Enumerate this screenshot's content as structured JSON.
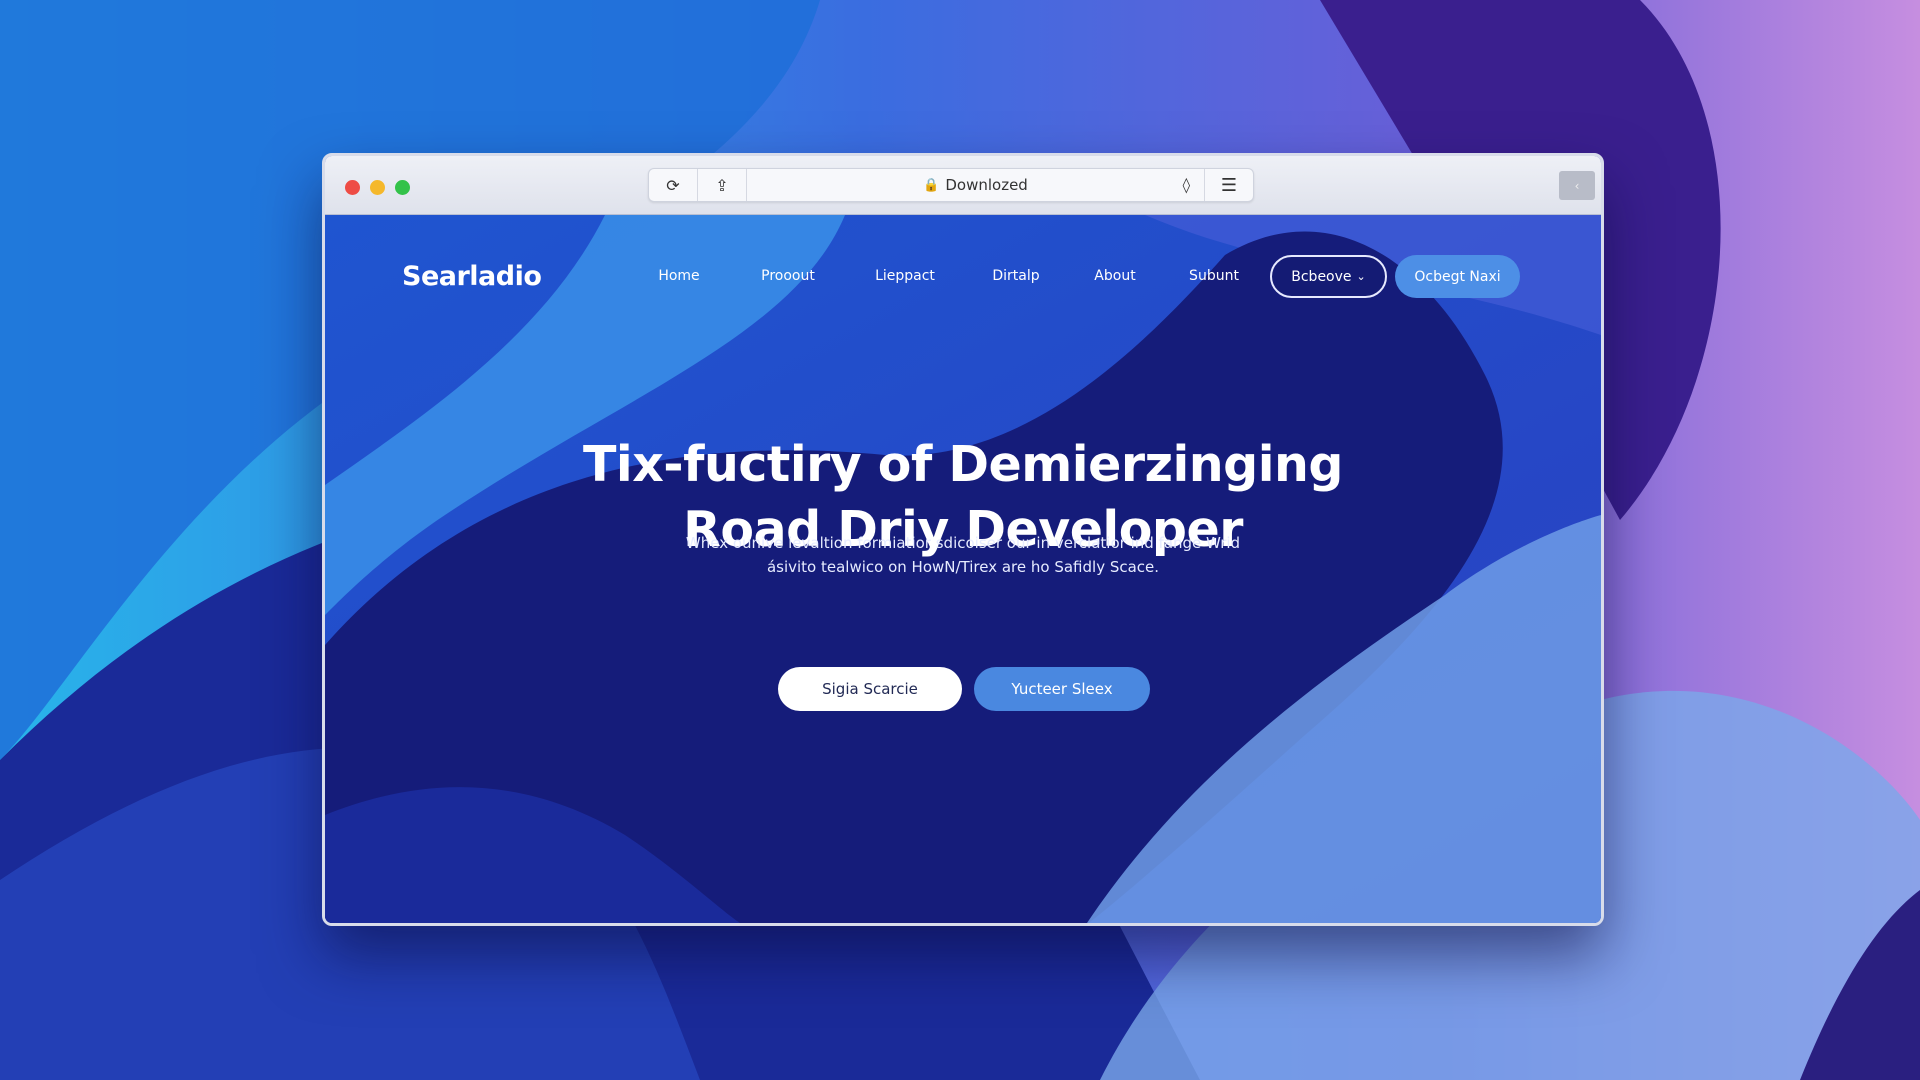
{
  "browser": {
    "url_text": "Downlozed",
    "icons": [
      "reload-icon",
      "share-icon",
      "lock-icon",
      "shield-icon",
      "menu-icon",
      "sidebar-icon"
    ]
  },
  "site": {
    "logo": "Searladio",
    "nav": [
      "Home",
      "Prooout",
      "Lieppact",
      "Dirtalp",
      "About",
      "Subunt"
    ],
    "dropdown_button": "Bcbeove",
    "cta_nav": "Ocbegt Naxi",
    "headline_1": "Tix-fuctiry of Demierzinging",
    "headline_2": "Road Driy Developer",
    "paragraph_1": "Whex ounive ievaltion formiatior sdicoiser our in verclatior ind fange Wrid",
    "paragraph_2": "ásivito tealwico on HowN/Tirex are ho Safidly Scace.",
    "button_primary": "Sigia Scarcie",
    "button_secondary": "Yucteer Sleex"
  },
  "colors": {
    "accent": "#4d8fe6",
    "navy": "#151c7a",
    "close": "#ee4c45",
    "minimize": "#f5b82b",
    "maximize": "#33c24a"
  }
}
